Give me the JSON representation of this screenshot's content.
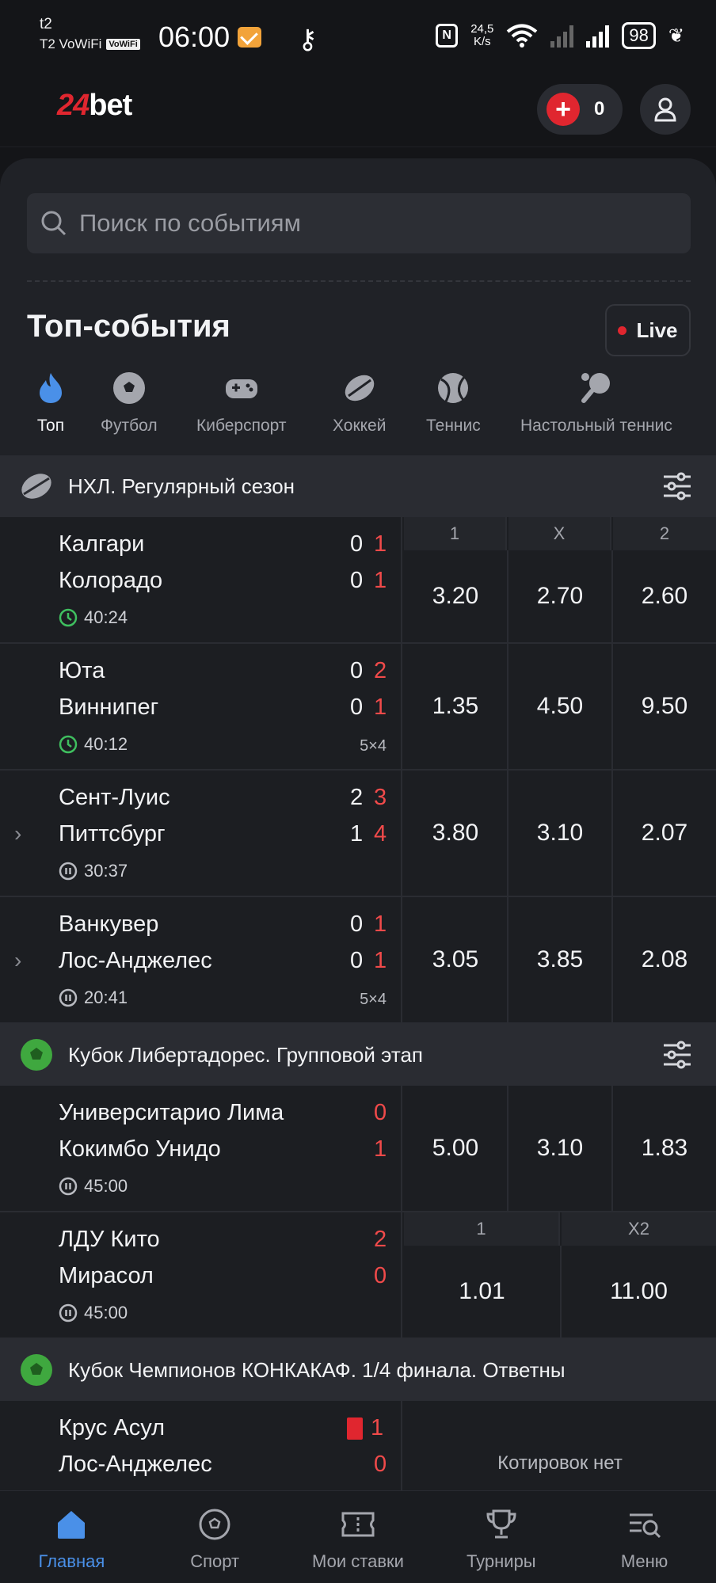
{
  "status_bar": {
    "carrier_top": "t2",
    "carrier_bottom": "T2 VoWiFi",
    "vowifi_badge": "VoWiFi",
    "time": "06:00",
    "speed_top": "24,5",
    "speed_bottom": "K/s",
    "battery": "98"
  },
  "header": {
    "logo_num": "24",
    "logo_text": "bet",
    "balance": "0"
  },
  "search": {
    "placeholder": "Поиск по событиям"
  },
  "section_title": "Топ-события",
  "live_label": "Live",
  "sports": [
    {
      "label": "Топ",
      "icon": "flame-icon",
      "active": true
    },
    {
      "label": "Футбол",
      "icon": "football-icon"
    },
    {
      "label": "Киберспорт",
      "icon": "gamepad-icon"
    },
    {
      "label": "Хоккей",
      "icon": "hockey-puck-icon"
    },
    {
      "label": "Теннис",
      "icon": "tennis-ball-icon"
    },
    {
      "label": "Настольный теннис",
      "icon": "table-tennis-icon"
    }
  ],
  "leagues": [
    {
      "name": "НХЛ. Регулярный сезон",
      "headers": [
        "1",
        "X",
        "2"
      ],
      "matches": [
        {
          "team1": "Калгари",
          "team2": "Колорадо",
          "s1a": "0",
          "s1b": "1",
          "s2a": "0",
          "s2b": "1",
          "time": "40:24",
          "clock": "running",
          "extra": "",
          "odds": [
            "3.20",
            "2.70",
            "2.60"
          ]
        },
        {
          "team1": "Юта",
          "team2": "Виннипег",
          "s1a": "0",
          "s1b": "2",
          "s2a": "0",
          "s2b": "1",
          "time": "40:12",
          "clock": "running",
          "extra": "5×4",
          "odds": [
            "1.35",
            "4.50",
            "9.50"
          ]
        },
        {
          "team1": "Сент-Луис",
          "team2": "Питтсбург",
          "s1a": "2",
          "s1b": "3",
          "s2a": "1",
          "s2b": "4",
          "time": "30:37",
          "clock": "paused",
          "extra": "",
          "odds": [
            "3.80",
            "3.10",
            "2.07"
          ]
        },
        {
          "team1": "Ванкувер",
          "team2": "Лос-Анджелес",
          "s1a": "0",
          "s1b": "1",
          "s2a": "0",
          "s2b": "1",
          "time": "20:41",
          "clock": "paused",
          "extra": "5×4",
          "odds": [
            "3.05",
            "3.85",
            "2.08"
          ]
        }
      ]
    },
    {
      "name": "Кубок Либертадорес. Групповой этап",
      "matches": [
        {
          "team1": "Университарио Лима",
          "team2": "Кокимбо Унидо",
          "s1": "0",
          "s2": "1",
          "time": "45:00",
          "odds": [
            "5.00",
            "3.10",
            "1.83"
          ]
        },
        {
          "team1": "ЛДУ Кито",
          "team2": "Мирасол",
          "s1": "2",
          "s2": "0",
          "time": "45:00",
          "headers": [
            "1",
            "X2"
          ],
          "odds": [
            "1.01",
            "11.00"
          ]
        }
      ]
    },
    {
      "name": "Кубок Чемпионов КОНКАКАФ. 1/4 финала. Ответны",
      "matches": [
        {
          "team1": "Крус Асул",
          "team2": "Лос-Анджелес",
          "s1": "1",
          "s2": "0",
          "no_odds": "Котировок нет"
        }
      ]
    }
  ],
  "bottom_nav": [
    {
      "label": "Главная",
      "icon": "home-icon",
      "active": true
    },
    {
      "label": "Спорт",
      "icon": "ball-icon"
    },
    {
      "label": "Мои ставки",
      "icon": "ticket-icon"
    },
    {
      "label": "Турниры",
      "icon": "trophy-icon"
    },
    {
      "label": "Меню",
      "icon": "menu-search-icon"
    }
  ],
  "colors": {
    "accent_red": "#e0262f",
    "active_blue": "#4a90e8",
    "panel_bg": "#202227"
  }
}
